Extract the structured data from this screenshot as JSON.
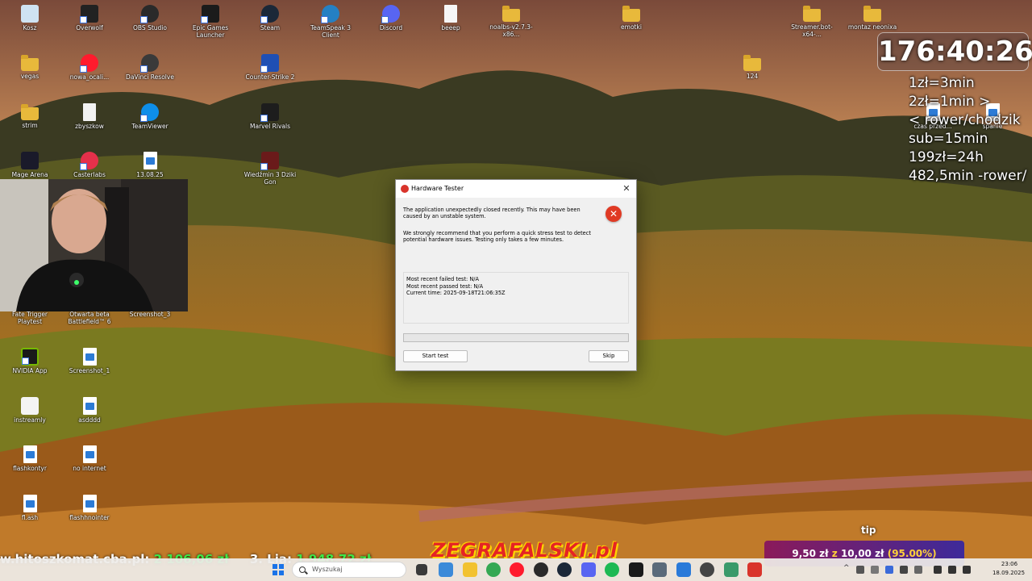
{
  "desktop": {
    "icons": [
      {
        "label": "Kosz"
      },
      {
        "label": "Overwolf"
      },
      {
        "label": "OBS Studio"
      },
      {
        "label": "Epic Games Launcher"
      },
      {
        "label": "Steam"
      },
      {
        "label": "TeamSpeak 3 Client"
      },
      {
        "label": "Discord"
      },
      {
        "label": "beeep"
      },
      {
        "label": "noalbs-v2.7.3-x86..."
      },
      {
        "label": "emotki"
      },
      {
        "label": "Streamer.bot-x64-..."
      },
      {
        "label": "montaz neonixa"
      },
      {
        "label": "vegas"
      },
      {
        "label": "nowa_ocali..."
      },
      {
        "label": "DaVinci Resolve"
      },
      {
        "label": "Counter-Strike 2"
      },
      {
        "label": "124"
      },
      {
        "label": "strim"
      },
      {
        "label": "zbyszkow"
      },
      {
        "label": "TeamViewer"
      },
      {
        "label": "Marvel Rivals"
      },
      {
        "label": "Mage Arena"
      },
      {
        "label": "Casterlabs"
      },
      {
        "label": "13.08.25"
      },
      {
        "label": "Wiedźmin 3 Dziki Gon"
      },
      {
        "label": "Fate Trigger Playtest"
      },
      {
        "label": "Otwarta beta Battlefield™ 6"
      },
      {
        "label": "Screenshot_3"
      },
      {
        "label": "NVIDIA App"
      },
      {
        "label": "Screenshot_1"
      },
      {
        "label": "instreamly"
      },
      {
        "label": "asdddd"
      },
      {
        "label": "flashkontyr"
      },
      {
        "label": "no internet"
      },
      {
        "label": "fl.ash"
      },
      {
        "label": "flashhnointer"
      },
      {
        "label": "czas przed..."
      },
      {
        "label": "spanie"
      }
    ]
  },
  "overlay": {
    "timer": "176:40:26",
    "rates": [
      "1zł=3min",
      "2zł=1min >",
      "< rower/chodzik",
      "sub=15min",
      "199zł=24h",
      "482,5min -rower/"
    ],
    "tip_label": "tip",
    "donation": {
      "amount": "9,50 zł",
      "of": "z",
      "goal": "10,00 zł",
      "percent": "(95.00%)"
    },
    "ticker": {
      "site": "w.hitoszkomat.cba.pl:",
      "site_value": "2 106,06 zł",
      "lia": "3. Lia:",
      "lia_value": "1 948,72 zł"
    },
    "brand": "ZEGRAFALSKI.pl"
  },
  "dialog": {
    "title": "Hardware Tester",
    "message1": "The application unexpectedly closed recently. This may have been caused by an unstable system.",
    "message2": "We strongly recommend that you perform a quick stress test to detect potential hardware issues. Testing only takes a few minutes.",
    "info": {
      "failed": "Most recent failed test: N/A",
      "passed": "Most recent passed test: N/A",
      "time": "Current time: 2025-09-18T21:06:35Z"
    },
    "progress": 0,
    "start_label": "Start test",
    "skip_label": "Skip",
    "close_glyph": "✕",
    "error_glyph": "✕"
  },
  "taskbar": {
    "search_placeholder": "Wyszukaj",
    "clock_time": "23:06",
    "clock_date": "18.09.2025",
    "tray_chevron": "^"
  },
  "colors": {
    "accent": "#1a73e8",
    "error": "#e03a24",
    "donation_highlight": "#ffd23a",
    "ticker_green": "#3ee84a"
  }
}
